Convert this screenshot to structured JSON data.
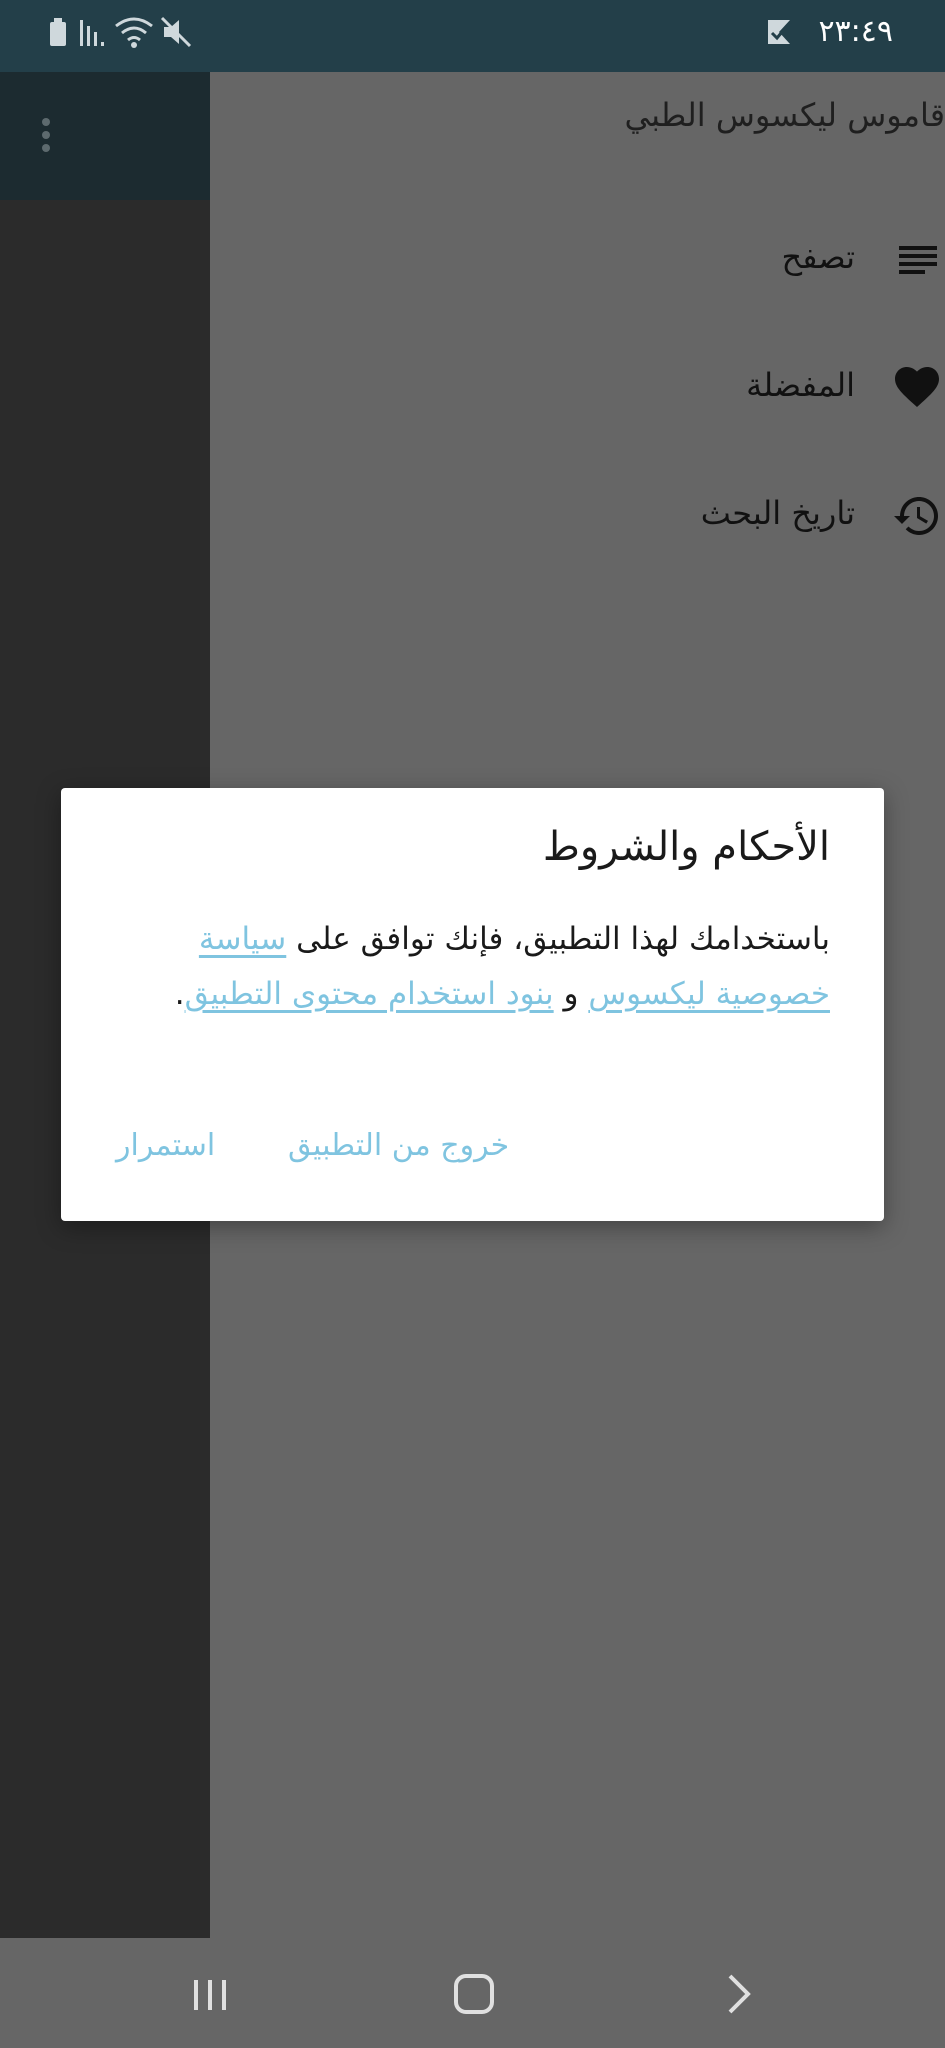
{
  "status_bar": {
    "time": "٢٣:٤٩",
    "icons": [
      "battery-icon",
      "signal-icon",
      "wifi-icon",
      "mute-icon",
      "notification-check-icon"
    ]
  },
  "app": {
    "menu_icon": "overflow-menu-icon"
  },
  "drawer": {
    "title": "قاموس ليكسوس الطبي",
    "items": [
      {
        "label": "تصفح",
        "icon": "list-icon"
      },
      {
        "label": "المفضلة",
        "icon": "heart-icon"
      },
      {
        "label": "تاريخ البحث",
        "icon": "history-icon"
      }
    ]
  },
  "dialog": {
    "title": "الأحكام والشروط",
    "body_prefix": "باستخدامك لهذا التطبيق، فإنك توافق على ",
    "privacy_link": "سياسة خصوصية ليكسوس",
    "conjunction": " و ",
    "terms_link": "بنود استخدام محتوى التطبيق",
    "body_suffix": ".",
    "exit_button": "خروج من التطبيق",
    "continue_button": "استمرار"
  },
  "colors": {
    "status_bar": "#233f49",
    "drawer_bg": "#666666",
    "link": "#7fc4e0"
  }
}
